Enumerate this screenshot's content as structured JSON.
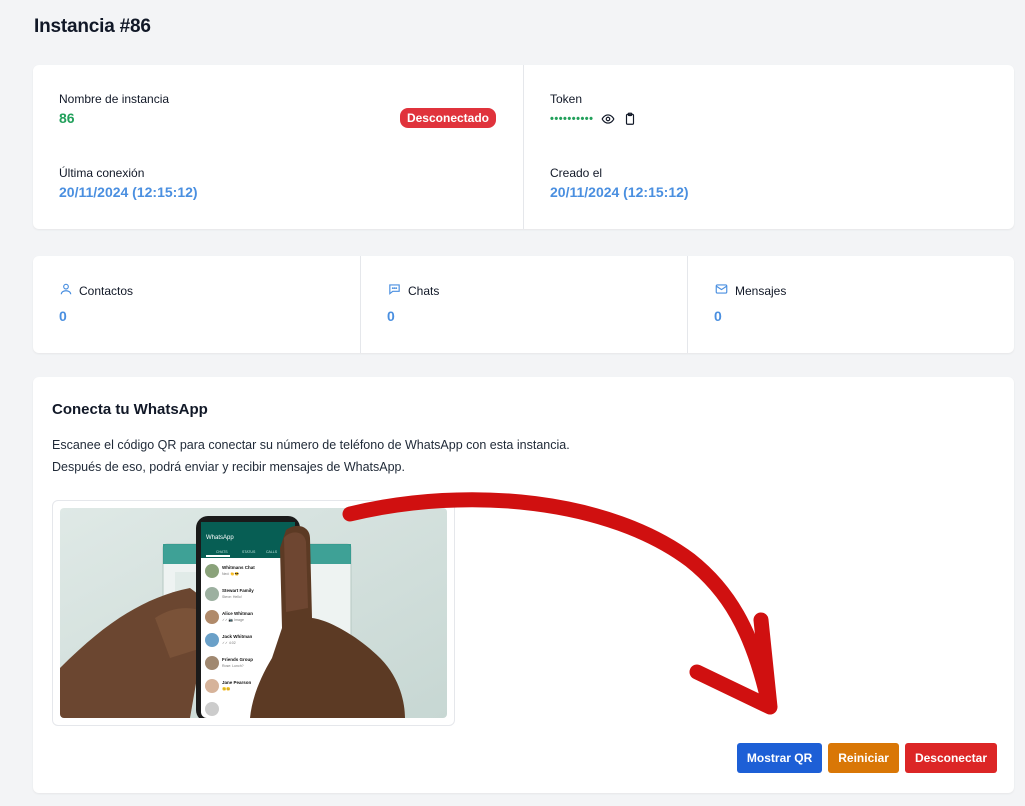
{
  "page": {
    "title": "Instancia #86"
  },
  "instance": {
    "name_label": "Nombre de instancia",
    "name_value": "86",
    "status_badge": "Desconectado",
    "last_connection_label": "Última conexión",
    "last_connection_value": "20/11/2024 (12:15:12)",
    "token_label": "Token",
    "token_masked": "••••••••••",
    "created_label": "Creado el",
    "created_value": "20/11/2024 (12:15:12)"
  },
  "stats": [
    {
      "label": "Contactos",
      "value": "0",
      "icon": "user-icon"
    },
    {
      "label": "Chats",
      "value": "0",
      "icon": "chat-icon"
    },
    {
      "label": "Mensajes",
      "value": "0",
      "icon": "mail-icon"
    }
  ],
  "connect": {
    "title": "Conecta tu WhatsApp",
    "desc_line1": "Escanee el código QR para conectar su número de teléfono de WhatsApp con esta instancia.",
    "desc_line2": "Después de eso, podrá enviar y recibir mensajes de WhatsApp.",
    "phone_app_title": "WhatsApp",
    "phone_tabs": [
      "CHATS",
      "STATUS",
      "CALLS"
    ],
    "phone_chats": [
      {
        "name": "Whitmans Chat",
        "preview": "Ned: 👏😎"
      },
      {
        "name": "Stewart Family",
        "preview": "Steve: Hello!"
      },
      {
        "name": "Alice Whitman",
        "preview": "✓✓ 📷 Image"
      },
      {
        "name": "Jack Whitman",
        "preview": "✓✓ 4:02"
      },
      {
        "name": "Friends Group",
        "preview": "Rose: Lunch?"
      },
      {
        "name": "Jane Pearson",
        "preview": "🙂😊"
      }
    ]
  },
  "actions": {
    "show_qr": "Mostrar QR",
    "restart": "Reiniciar",
    "disconnect": "Desconectar"
  },
  "colors": {
    "accent_blue": "#4a8fe0",
    "status_green": "#22a05b",
    "danger_red": "#e0333c",
    "btn_blue": "#1d5fd6",
    "btn_orange": "#d97706",
    "btn_red": "#dc2626",
    "annotation_arrow": "#d01010"
  }
}
